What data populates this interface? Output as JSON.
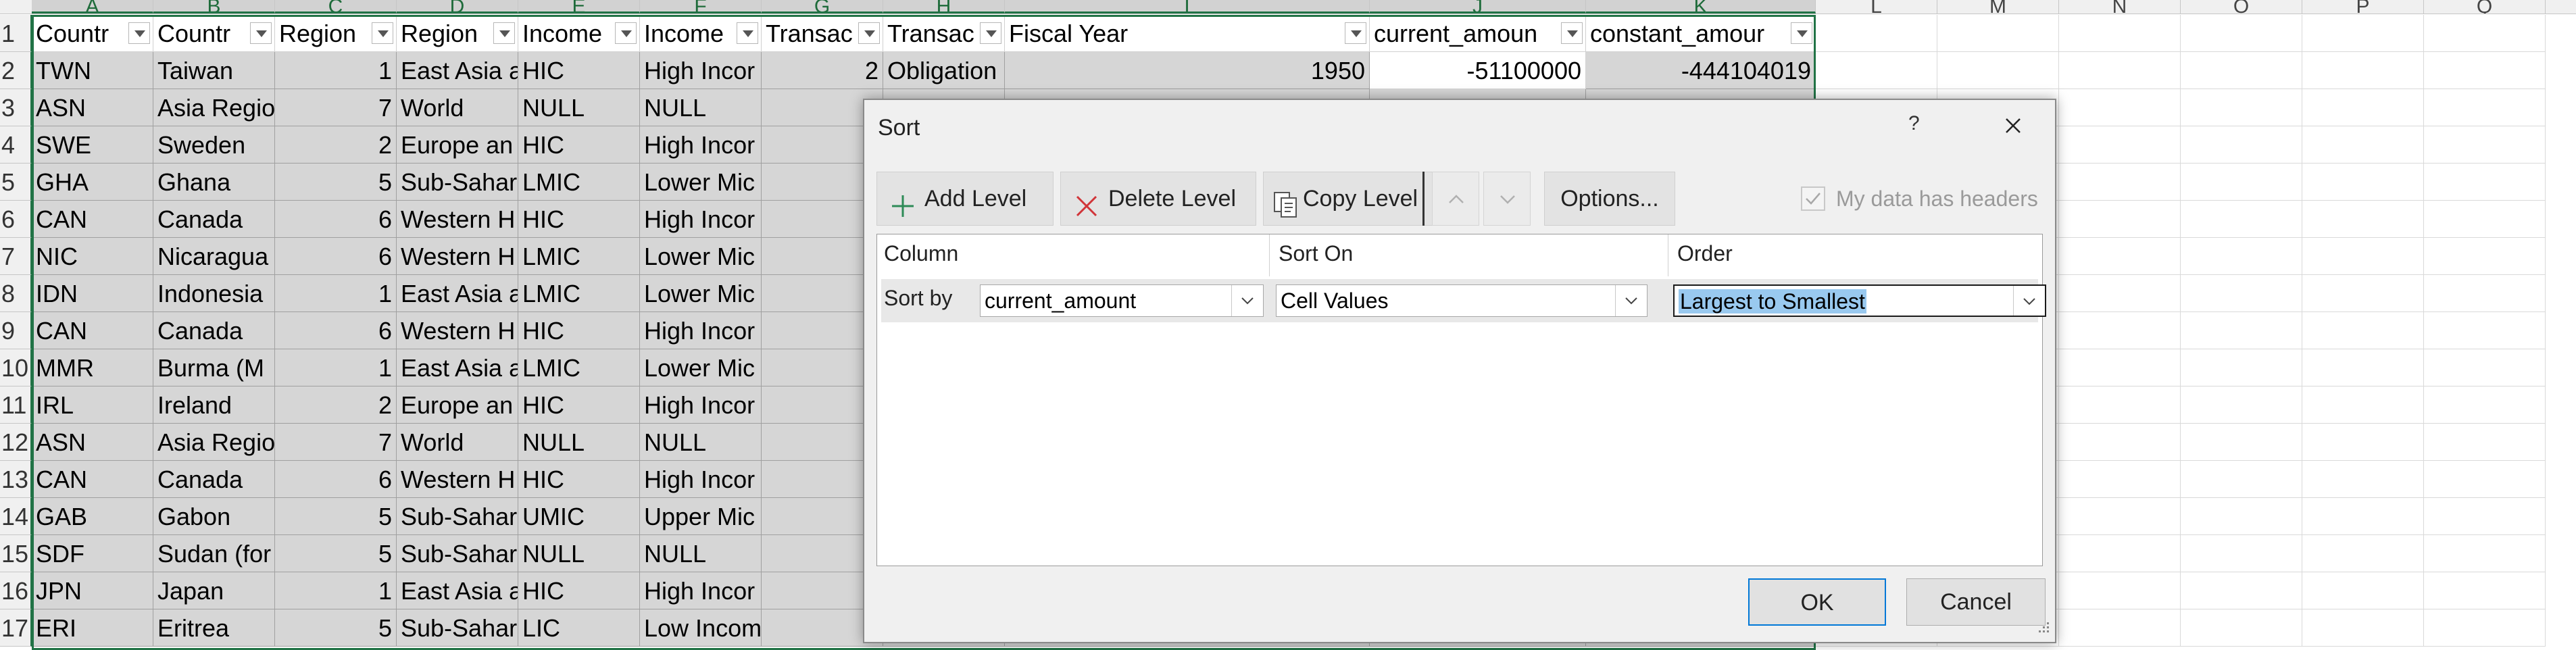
{
  "sheet": {
    "columns": [
      "A",
      "B",
      "C",
      "D",
      "E",
      "F",
      "G",
      "H",
      "I",
      "J",
      "K",
      "L",
      "M",
      "N",
      "O",
      "P",
      "Q"
    ],
    "row_numbers": [
      "1",
      "2",
      "3",
      "4",
      "5",
      "6",
      "7",
      "8",
      "9",
      "10",
      "11",
      "12",
      "13",
      "14",
      "15",
      "16",
      "17"
    ],
    "headers": [
      "Countr",
      "Countr",
      "Region",
      "Region",
      "Income",
      "Income",
      "Transac",
      "Transac",
      "Fiscal Year",
      "current_amoun",
      "constant_amour"
    ],
    "rows": [
      [
        "TWN",
        "Taiwan",
        "1",
        "East Asia a",
        "HIC",
        "High Incor",
        "2",
        "Obligation",
        "1950",
        "-51100000",
        "-444104019"
      ],
      [
        "ASN",
        "Asia Regio",
        "7",
        "World",
        "NULL",
        "NULL"
      ],
      [
        "SWE",
        "Sweden",
        "2",
        "Europe an",
        "HIC",
        "High Incor"
      ],
      [
        "GHA",
        "Ghana",
        "5",
        "Sub-Sahar",
        "LMIC",
        "Lower Mic"
      ],
      [
        "CAN",
        "Canada",
        "6",
        "Western H",
        "HIC",
        "High Incor"
      ],
      [
        "NIC",
        "Nicaragua",
        "6",
        "Western H",
        "LMIC",
        "Lower Mic"
      ],
      [
        "IDN",
        "Indonesia",
        "1",
        "East Asia a",
        "LMIC",
        "Lower Mic"
      ],
      [
        "CAN",
        "Canada",
        "6",
        "Western H",
        "HIC",
        "High Incor"
      ],
      [
        "MMR",
        "Burma (M",
        "1",
        "East Asia a",
        "LMIC",
        "Lower Mic"
      ],
      [
        "IRL",
        "Ireland",
        "2",
        "Europe an",
        "HIC",
        "High Incor"
      ],
      [
        "ASN",
        "Asia Regio",
        "7",
        "World",
        "NULL",
        "NULL"
      ],
      [
        "CAN",
        "Canada",
        "6",
        "Western H",
        "HIC",
        "High Incor"
      ],
      [
        "GAB",
        "Gabon",
        "5",
        "Sub-Sahar",
        "UMIC",
        "Upper Mic"
      ],
      [
        "SDF",
        "Sudan (for",
        "5",
        "Sub-Sahar",
        "NULL",
        "NULL"
      ],
      [
        "JPN",
        "Japan",
        "1",
        "East Asia a",
        "HIC",
        "High Incor"
      ],
      [
        "ERI",
        "Eritrea",
        "5",
        "Sub-Sahar",
        "LIC",
        "Low Incom"
      ]
    ]
  },
  "dialog": {
    "title": "Sort",
    "help": "?",
    "toolbar": {
      "add_level": "Add Level",
      "delete_level": "Delete Level",
      "copy_level": "Copy Level",
      "options": "Options..."
    },
    "my_data_has_headers": "My data has headers",
    "grid_headers": {
      "column": "Column",
      "sort_on": "Sort On",
      "order": "Order"
    },
    "level": {
      "sort_by_label": "Sort by",
      "column_value": "current_amount",
      "sort_on_value": "Cell Values",
      "order_value": "Largest to Smallest"
    },
    "ok": "OK",
    "cancel": "Cancel"
  },
  "icons": {
    "add": "plus-icon",
    "delete": "x-icon",
    "copy": "copy-icon",
    "up": "arrow-up-icon",
    "down": "arrow-down-icon",
    "filter": "filter-dropdown-icon",
    "close": "close-icon",
    "dropdown": "chevron-down-icon"
  },
  "colors": {
    "excel_green": "#217346",
    "selection_gray": "#d6d6d6",
    "highlight_blue": "#99c9ef",
    "ok_border": "#0078d7",
    "add_icon": "#2e8b57",
    "delete_icon": "#d13438"
  }
}
